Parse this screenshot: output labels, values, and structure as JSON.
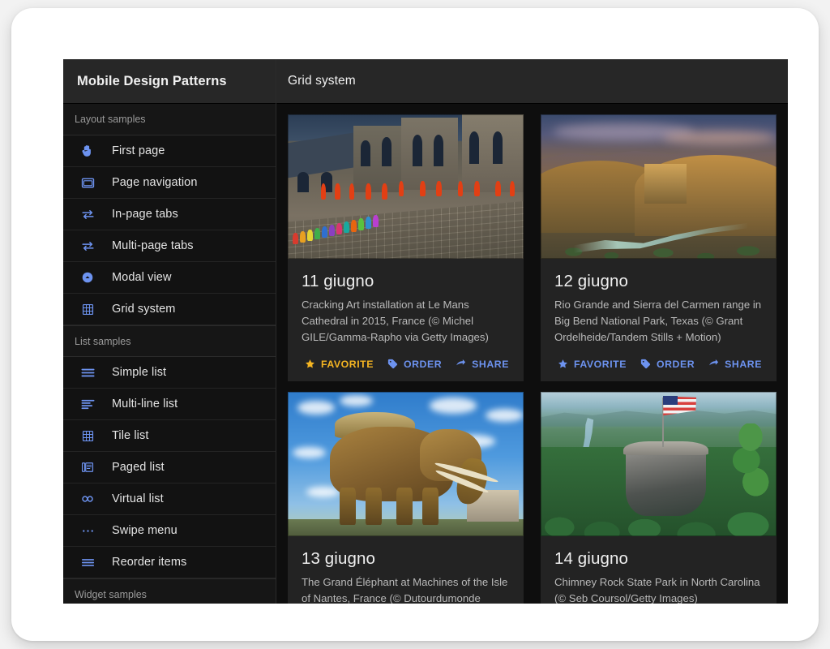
{
  "app": {
    "sidebar_title": "Mobile Design Patterns",
    "content_title": "Grid system"
  },
  "sidebar": {
    "sections": [
      {
        "label": "Layout samples",
        "items": [
          {
            "label": "First page",
            "icon": "hand-icon"
          },
          {
            "label": "Page navigation",
            "icon": "window-icon"
          },
          {
            "label": "In-page tabs",
            "icon": "swap-arrows-icon"
          },
          {
            "label": "Multi-page tabs",
            "icon": "swap-arrows-icon"
          },
          {
            "label": "Modal view",
            "icon": "modal-circle-icon"
          },
          {
            "label": "Grid system",
            "icon": "grid-icon"
          }
        ]
      },
      {
        "label": "List samples",
        "items": [
          {
            "label": "Simple list",
            "icon": "list-lines-icon"
          },
          {
            "label": "Multi-line list",
            "icon": "multiline-list-icon"
          },
          {
            "label": "Tile list",
            "icon": "grid-icon"
          },
          {
            "label": "Paged list",
            "icon": "paged-list-icon"
          },
          {
            "label": "Virtual list",
            "icon": "infinity-icon"
          },
          {
            "label": "Swipe menu",
            "icon": "dots-horizontal-icon"
          },
          {
            "label": "Reorder items",
            "icon": "reorder-lines-icon"
          }
        ]
      },
      {
        "label": "Widget samples",
        "items": []
      }
    ]
  },
  "grid": {
    "cards": [
      {
        "title": "11 giugno",
        "text": "Cracking Art installation at Le Mans Cathedral in 2015, France (© Michel GILE/Gamma-Rapho via Getty Images)",
        "art": "art-cathedral",
        "actions": [
          {
            "label": "FAVORITE",
            "icon": "star-icon",
            "favorited": true
          },
          {
            "label": "ORDER",
            "icon": "tag-icon",
            "favorited": false
          },
          {
            "label": "SHARE",
            "icon": "share-icon",
            "favorited": false
          }
        ]
      },
      {
        "title": "12 giugno",
        "text": "Rio Grande and Sierra del Carmen range in Big Bend National Park, Texas (© Grant Ordelheide/Tandem Stills + Motion)",
        "art": "art-riogrande",
        "actions": [
          {
            "label": "FAVORITE",
            "icon": "star-icon",
            "favorited": false
          },
          {
            "label": "ORDER",
            "icon": "tag-icon",
            "favorited": false
          },
          {
            "label": "SHARE",
            "icon": "share-icon",
            "favorited": false
          }
        ]
      },
      {
        "title": "13 giugno",
        "text": "The Grand Éléphant at Machines of the Isle of Nantes, France (© Dutourdumonde",
        "art": "art-elephant",
        "actions": []
      },
      {
        "title": "14 giugno",
        "text": "Chimney Rock State Park in North Carolina (© Seb Coursol/Getty Images)",
        "art": "art-chimney",
        "actions": []
      }
    ]
  },
  "colors": {
    "accent": "#6d93f0",
    "favorited": "#f5b522",
    "app_background": "#121212",
    "card_background": "#232323",
    "header_background": "#272727",
    "page_background": "#f2f2f2"
  }
}
